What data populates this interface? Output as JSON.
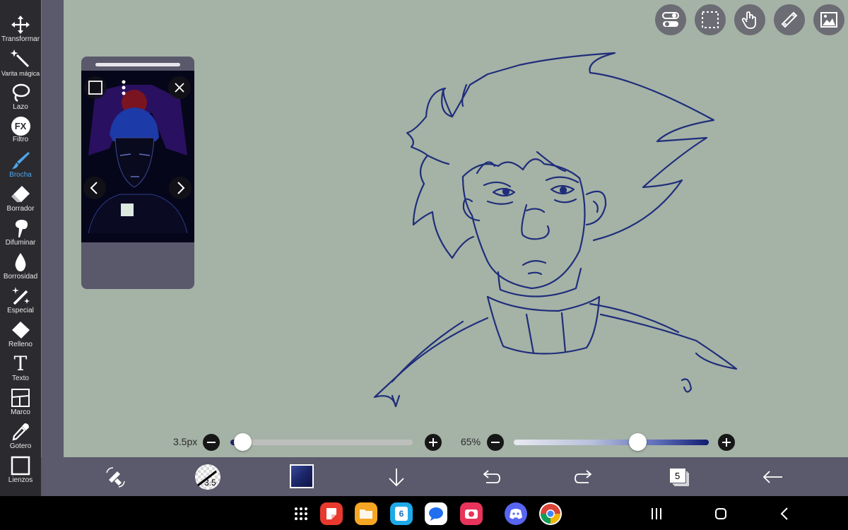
{
  "toolbar": {
    "tools": [
      {
        "label": "Transformar",
        "icon": "move-arrows-icon"
      },
      {
        "label": "Varita mágica",
        "icon": "magic-wand-icon"
      },
      {
        "label": "Lazo",
        "icon": "lasso-icon"
      },
      {
        "label": "Filtro",
        "icon": "fx-icon"
      },
      {
        "label": "Brocha",
        "icon": "brush-icon",
        "active": true
      },
      {
        "label": "Borrador",
        "icon": "eraser-icon"
      },
      {
        "label": "Difuminar",
        "icon": "smudge-icon"
      },
      {
        "label": "Borrosidad",
        "icon": "blur-drop-icon"
      },
      {
        "label": "Especial",
        "icon": "sparkle-wand-icon"
      },
      {
        "label": "Relleno",
        "icon": "fill-bucket-icon"
      },
      {
        "label": "Texto",
        "icon": "text-t-icon"
      },
      {
        "label": "Marco",
        "icon": "frame-divider-icon"
      },
      {
        "label": "Gotero",
        "icon": "eyedropper-icon"
      },
      {
        "label": "Lienzos",
        "icon": "canvas-square-icon"
      }
    ],
    "fx_text": "FX",
    "text_glyph": "T"
  },
  "sliders": {
    "brush_size": {
      "label": "3.5px",
      "value": 3.5
    },
    "opacity": {
      "label": "65%",
      "value": 0.65
    }
  },
  "bottom": {
    "brush_size_badge": "3.5",
    "layers_count": "5"
  },
  "colors": {
    "canvas": "#a5b2a6",
    "stroke": "#1f2e7a",
    "accent": "#4fa6ec",
    "current_color": "#1c2668"
  },
  "android": {
    "calendar_day": "6"
  }
}
